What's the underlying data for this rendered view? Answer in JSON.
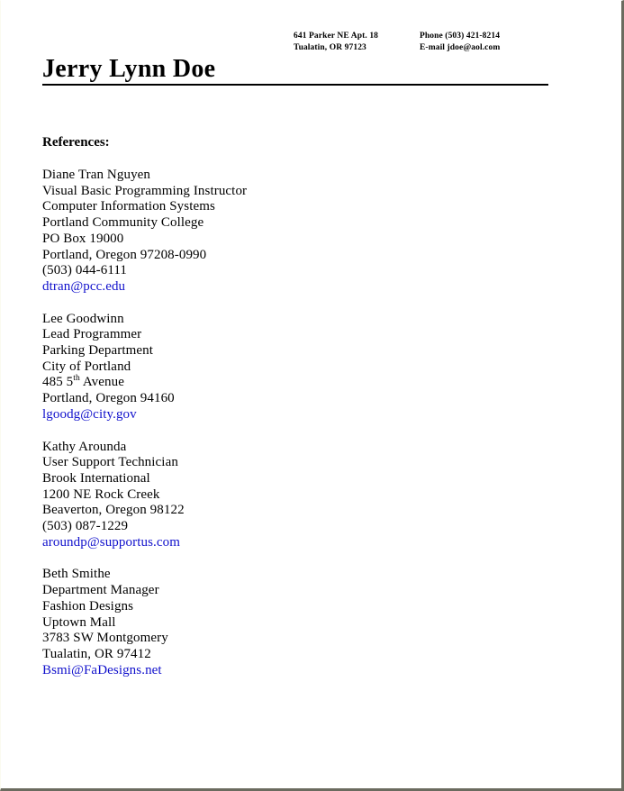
{
  "header": {
    "address": {
      "street": "641 Parker NE Apt. 18",
      "city_state_zip": "Tualatin, OR 97123"
    },
    "contact": {
      "phone": "Phone (503) 421-8214",
      "email": "E-mail jdoe@aol.com"
    },
    "name": "Jerry Lynn Doe"
  },
  "section": {
    "heading": "References:"
  },
  "references": [
    {
      "name": "Diane Tran Nguyen",
      "title": "Visual Basic Programming Instructor",
      "department": "Computer Information Systems",
      "organization": "Portland Community College",
      "address1": "PO Box 19000",
      "address2": "Portland, Oregon 97208-0990",
      "phone": "(503) 044-6111",
      "email": "dtran@pcc.edu"
    },
    {
      "name": "Lee Goodwinn",
      "title": "Lead Programmer",
      "department": "Parking Department",
      "organization": "City of Portland",
      "address1_prefix": "485 5",
      "address1_sup": "th",
      "address1_suffix": " Avenue",
      "address2": "Portland, Oregon 94160",
      "email": "lgoodg@city.gov"
    },
    {
      "name": "Kathy Arounda",
      "title": "User Support Technician",
      "organization": "Brook International",
      "address1": "1200 NE Rock Creek",
      "address2": "Beaverton, Oregon 98122",
      "phone": "(503) 087-1229",
      "email": "aroundp@supportus.com"
    },
    {
      "name": "Beth Smithe",
      "title": "Department Manager",
      "department": "Fashion Designs",
      "organization": "Uptown Mall",
      "address1": "3783 SW Montgomery",
      "address2": "Tualatin, OR 97412",
      "email": "Bsmi@FaDesigns.net"
    }
  ],
  "colors": {
    "link": "#1111cc",
    "text": "#000000",
    "page_border": "#6b6b5f"
  }
}
